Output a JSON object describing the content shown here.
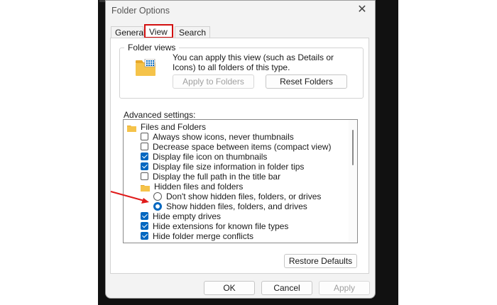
{
  "dialog": {
    "title": "Folder Options",
    "close_glyph": "✕",
    "tabs": [
      "General",
      "View",
      "Search"
    ],
    "active_tab": "View"
  },
  "folder_views": {
    "legend": "Folder views",
    "description": "You can apply this view (such as Details or Icons) to all folders of this type.",
    "apply_label": "Apply to Folders",
    "reset_label": "Reset Folders",
    "icon": "folder-view-icon"
  },
  "advanced": {
    "label": "Advanced settings:",
    "items": [
      {
        "kind": "folder",
        "label": "Files and Folders"
      },
      {
        "kind": "checkbox",
        "label": "Always show icons, never thumbnails",
        "checked": false
      },
      {
        "kind": "checkbox",
        "label": "Decrease space between items (compact view)",
        "checked": false
      },
      {
        "kind": "checkbox",
        "label": "Display file icon on thumbnails",
        "checked": true
      },
      {
        "kind": "checkbox",
        "label": "Display file size information in folder tips",
        "checked": true
      },
      {
        "kind": "checkbox",
        "label": "Display the full path in the title bar",
        "checked": false
      },
      {
        "kind": "folder",
        "label": "Hidden files and folders"
      },
      {
        "kind": "radio",
        "label": "Don't show hidden files, folders, or drives",
        "checked": false
      },
      {
        "kind": "radio",
        "label": "Show hidden files, folders, and drives",
        "checked": true
      },
      {
        "kind": "checkbox",
        "label": "Hide empty drives",
        "checked": true
      },
      {
        "kind": "checkbox",
        "label": "Hide extensions for known file types",
        "checked": true
      },
      {
        "kind": "checkbox",
        "label": "Hide folder merge conflicts",
        "checked": true
      }
    ]
  },
  "restore_label": "Restore Defaults",
  "footer": {
    "ok": "OK",
    "cancel": "Cancel",
    "apply": "Apply"
  },
  "colors": {
    "accent": "#0067c0",
    "highlight": "#d20f0f",
    "folder": "#f5c34a"
  }
}
